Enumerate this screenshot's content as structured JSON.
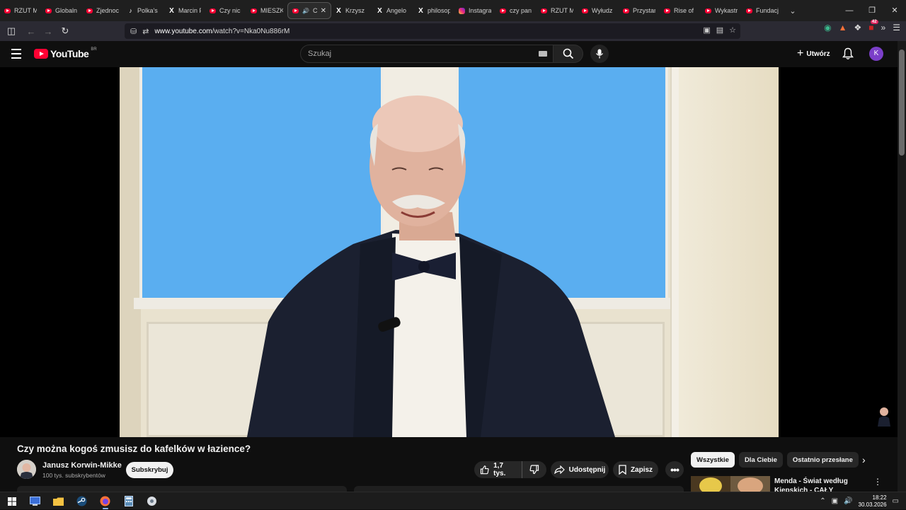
{
  "browser": {
    "tabs": [
      {
        "label": "RZUT M",
        "icon": "youtube-icon"
      },
      {
        "label": "Globaln",
        "icon": "youtube-icon"
      },
      {
        "label": "Zjednoc",
        "icon": "youtube-icon"
      },
      {
        "label": "Polka's",
        "icon": "tiktok-icon"
      },
      {
        "label": "Marcin P",
        "icon": "x-icon"
      },
      {
        "label": "Czy nic",
        "icon": "youtube-icon"
      },
      {
        "label": "MIESZK",
        "icon": "youtube-icon"
      },
      {
        "label": "Czy",
        "icon": "youtube-icon",
        "active": true
      },
      {
        "label": "Krzysz",
        "icon": "x-icon"
      },
      {
        "label": "Angelo",
        "icon": "x-icon"
      },
      {
        "label": "philosop",
        "icon": "x-icon"
      },
      {
        "label": "Instagra",
        "icon": "instagram-icon"
      },
      {
        "label": "czy pan",
        "icon": "youtube-icon"
      },
      {
        "label": "RZUT M",
        "icon": "youtube-icon"
      },
      {
        "label": "Wyłudz",
        "icon": "youtube-icon"
      },
      {
        "label": "Przystan",
        "icon": "youtube-icon"
      },
      {
        "label": "Rise of",
        "icon": "youtube-icon"
      },
      {
        "label": "Wykastr",
        "icon": "youtube-icon"
      },
      {
        "label": "Fundacj",
        "icon": "youtube-icon"
      }
    ],
    "url_domain": "www.youtube.com",
    "url_path": "/watch?v=Nka0Nu886rM",
    "extensions_badge": "42"
  },
  "youtube": {
    "logo_text": "YouTube",
    "region": "BR",
    "search_placeholder": "Szukaj",
    "create_label": "Utwórz",
    "avatar_letter": "K",
    "video_title": "Czy można kogoś zmusisz do kafelków w łazience?",
    "channel_name": "Janusz Korwin-Mikke",
    "subscribers": "100 tys. subskrybentów",
    "subscribe_label": "Subskrybuj",
    "likes": "1,7 tys.",
    "share_label": "Udostępnij",
    "save_label": "Zapisz",
    "chips": [
      "Wszystkie",
      "Dla Ciebie",
      "Ostatnio przesłane"
    ],
    "recommended_title": "Menda - Świat według Kiepskich - CAŁY ODCINEK"
  },
  "taskbar": {
    "time": "18:22",
    "date": "30.03.2026",
    "apps": [
      "windows-start-icon",
      "terminal-icon",
      "file-explorer-icon",
      "steam-icon",
      "firefox-icon",
      "calculator-icon",
      "settings-app-icon"
    ]
  }
}
